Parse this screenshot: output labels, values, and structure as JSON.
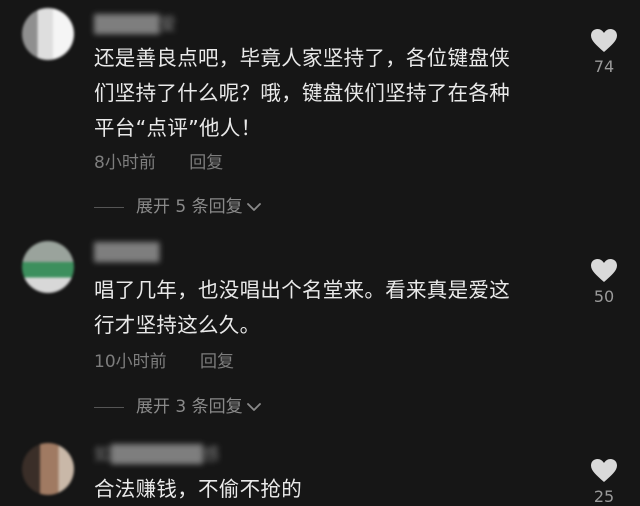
{
  "comments": [
    {
      "username": "█████爱",
      "text_lines": [
        "还是善良点吧，毕竟人家坚持了，各位键盘侠",
        "们坚持了什么呢？哦，键盘侠们坚持了在各种",
        "平台“点评”他人！"
      ],
      "time": "8小时前",
      "reply_label": "回复",
      "expand_label": "展开 5 条回复",
      "likes": "74"
    },
    {
      "username": "█████",
      "text_lines": [
        "唱了几年，也没唱出个名堂来。看来真是爱这",
        "行才坚持这么久。"
      ],
      "time": "10小时前",
      "reply_label": "回复",
      "expand_label": "展开 3 条回复",
      "likes": "50"
    },
    {
      "username": "如███████感",
      "text_lines": [
        "合法赚钱，不偷不抢的"
      ],
      "likes": "25"
    }
  ],
  "icons": {
    "like": "heart-icon",
    "expand": "chevron-down-icon"
  },
  "colors": {
    "background": "#161616",
    "text": "#e9e9e9",
    "meta": "#7d7d7d",
    "heart": "#d9d9d9"
  }
}
